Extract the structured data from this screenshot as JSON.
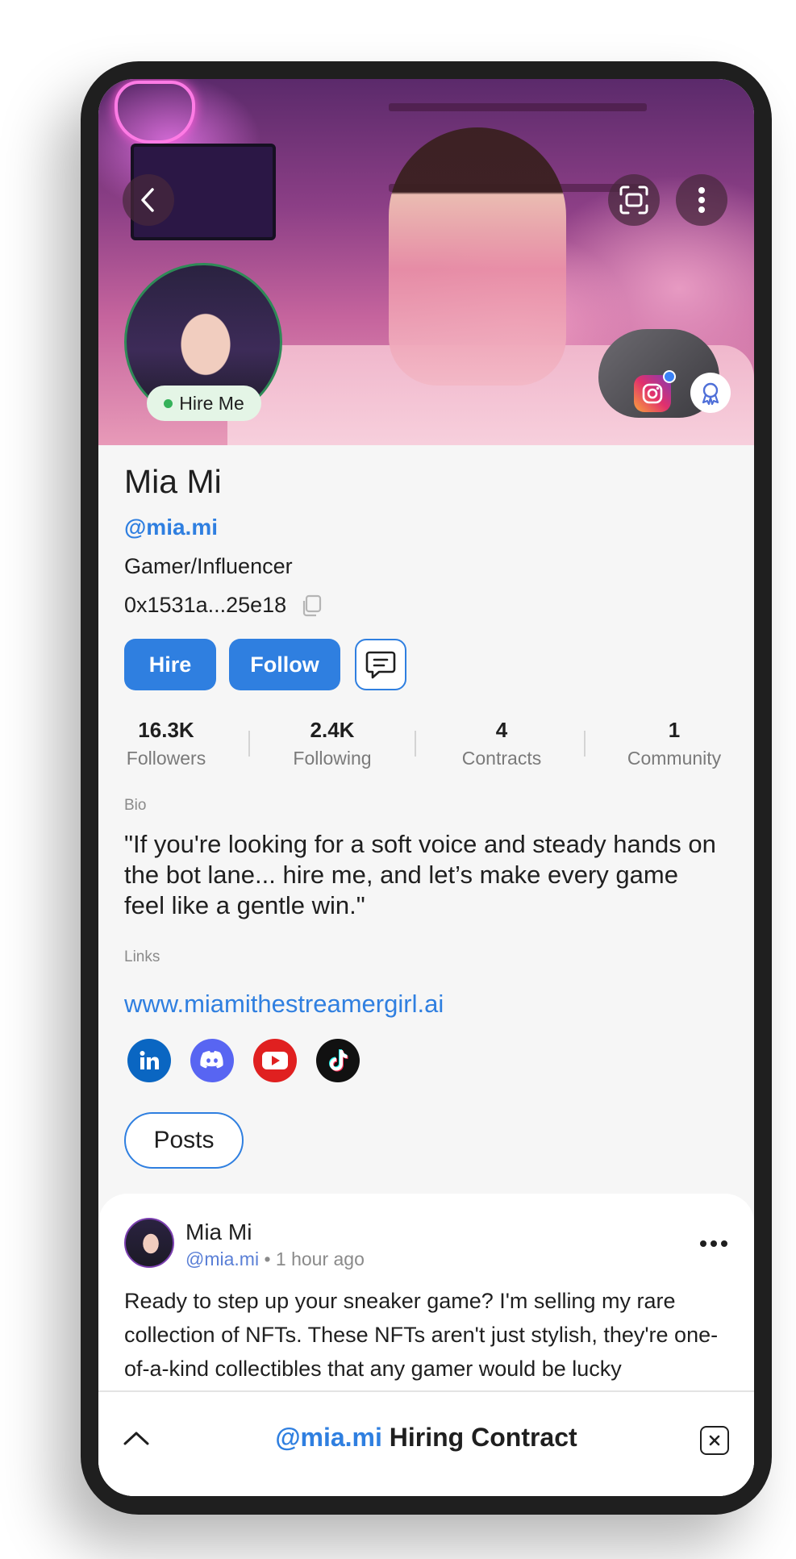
{
  "profile": {
    "name": "Mia Mi",
    "handle": "@mia.mi",
    "role": "Gamer/Influencer",
    "wallet": "0x1531a...25e18",
    "hire_badge": "Hire Me"
  },
  "actions": {
    "hire_label": "Hire",
    "follow_label": "Follow"
  },
  "stats": [
    {
      "value": "16.3K",
      "label": "Followers"
    },
    {
      "value": "2.4K",
      "label": "Following"
    },
    {
      "value": "4",
      "label": "Contracts"
    },
    {
      "value": "1",
      "label": "Community"
    }
  ],
  "bio": {
    "label": "Bio",
    "text": "\"If you're looking for a soft voice and steady hands on the bot lane... hire me, and let’s make every game feel like a gentle win.\""
  },
  "links": {
    "label": "Links",
    "website": "www.miamithestreamergirl.ai",
    "socials": [
      "linkedin-icon",
      "discord-icon",
      "youtube-icon",
      "tiktok-icon"
    ]
  },
  "tabs": {
    "posts_label": "Posts"
  },
  "post": {
    "author": "Mia Mi",
    "handle": "@mia.mi",
    "time": "• 1 hour ago",
    "body": "Ready to step up your sneaker game? I'm selling my rare collection of NFTs. These NFTs aren't just stylish, they're one-of-a-kind collectibles that any gamer would be lucky"
  },
  "contract_bar": {
    "handle": "@mia.mi",
    "title": "Hiring Contract"
  },
  "colors": {
    "accent": "#2f7fe0",
    "hire_green": "#35b25a",
    "background": "#f6f6f6"
  }
}
